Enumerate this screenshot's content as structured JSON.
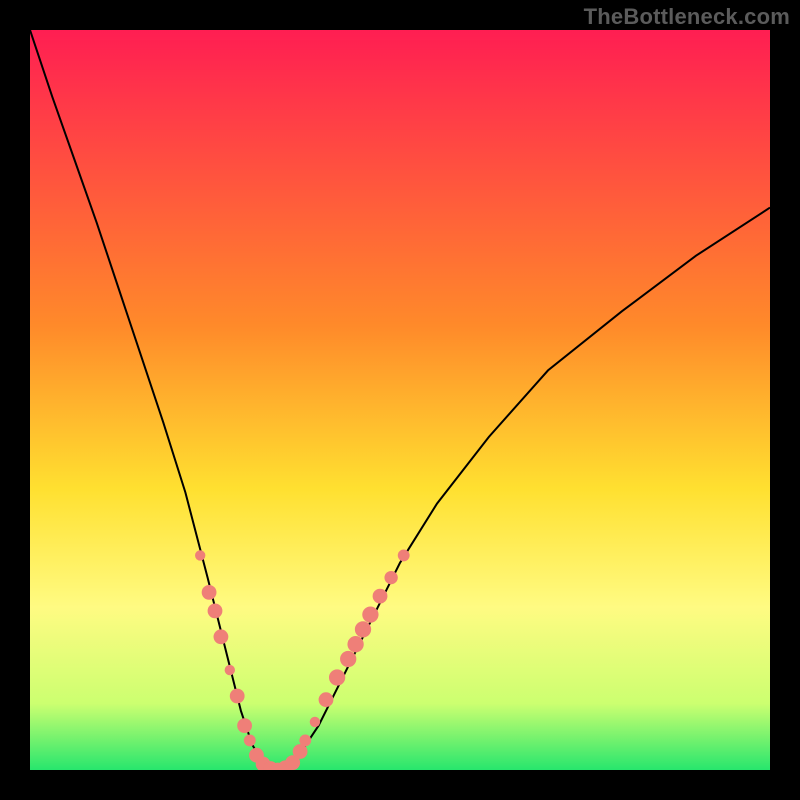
{
  "watermark": "TheBottleneck.com",
  "colors": {
    "background": "#000000",
    "gradient_top": "#ff1e52",
    "gradient_mid1": "#ff8a2a",
    "gradient_mid2": "#ffe030",
    "gradient_mid3": "#fffb82",
    "gradient_mid4": "#ccff70",
    "gradient_bottom": "#27e66d",
    "curve": "#000000",
    "marker": "#ef7f78"
  },
  "chart_data": {
    "type": "line",
    "title": "",
    "xlabel": "",
    "ylabel": "",
    "xlim": [
      0,
      100
    ],
    "ylim": [
      0,
      100
    ],
    "series": [
      {
        "name": "bottleneck-curve",
        "x": [
          0,
          3,
          6,
          9,
          12,
          15,
          18,
          21,
          24,
          27,
          28.5,
          30,
          31.5,
          33,
          34.5,
          36,
          39,
          42,
          46,
          50,
          55,
          62,
          70,
          80,
          90,
          100
        ],
        "y": [
          100,
          91,
          82.5,
          74,
          65,
          56,
          47,
          37.5,
          26,
          14,
          8,
          3.5,
          0.8,
          0,
          0.3,
          1.5,
          6,
          12,
          20,
          28,
          36,
          45,
          54,
          62,
          69.5,
          76
        ]
      }
    ],
    "markers": [
      {
        "x": 23.0,
        "y": 29.0,
        "r": 0.7
      },
      {
        "x": 24.2,
        "y": 24.0,
        "r": 1.0
      },
      {
        "x": 25.0,
        "y": 21.5,
        "r": 1.0
      },
      {
        "x": 25.8,
        "y": 18.0,
        "r": 1.0
      },
      {
        "x": 27.0,
        "y": 13.5,
        "r": 0.7
      },
      {
        "x": 28.0,
        "y": 10.0,
        "r": 1.0
      },
      {
        "x": 29.0,
        "y": 6.0,
        "r": 1.0
      },
      {
        "x": 29.7,
        "y": 4.0,
        "r": 0.8
      },
      {
        "x": 30.6,
        "y": 2.0,
        "r": 1.0
      },
      {
        "x": 31.5,
        "y": 0.8,
        "r": 1.0
      },
      {
        "x": 32.5,
        "y": 0.2,
        "r": 1.0
      },
      {
        "x": 33.5,
        "y": 0.0,
        "r": 1.0
      },
      {
        "x": 34.5,
        "y": 0.3,
        "r": 1.0
      },
      {
        "x": 35.5,
        "y": 1.0,
        "r": 1.0
      },
      {
        "x": 36.5,
        "y": 2.5,
        "r": 1.0
      },
      {
        "x": 37.2,
        "y": 4.0,
        "r": 0.8
      },
      {
        "x": 38.5,
        "y": 6.5,
        "r": 0.7
      },
      {
        "x": 40.0,
        "y": 9.5,
        "r": 1.0
      },
      {
        "x": 41.5,
        "y": 12.5,
        "r": 1.1
      },
      {
        "x": 43.0,
        "y": 15.0,
        "r": 1.1
      },
      {
        "x": 44.0,
        "y": 17.0,
        "r": 1.1
      },
      {
        "x": 45.0,
        "y": 19.0,
        "r": 1.1
      },
      {
        "x": 46.0,
        "y": 21.0,
        "r": 1.1
      },
      {
        "x": 47.3,
        "y": 23.5,
        "r": 1.0
      },
      {
        "x": 48.8,
        "y": 26.0,
        "r": 0.9
      },
      {
        "x": 50.5,
        "y": 29.0,
        "r": 0.8
      }
    ]
  }
}
